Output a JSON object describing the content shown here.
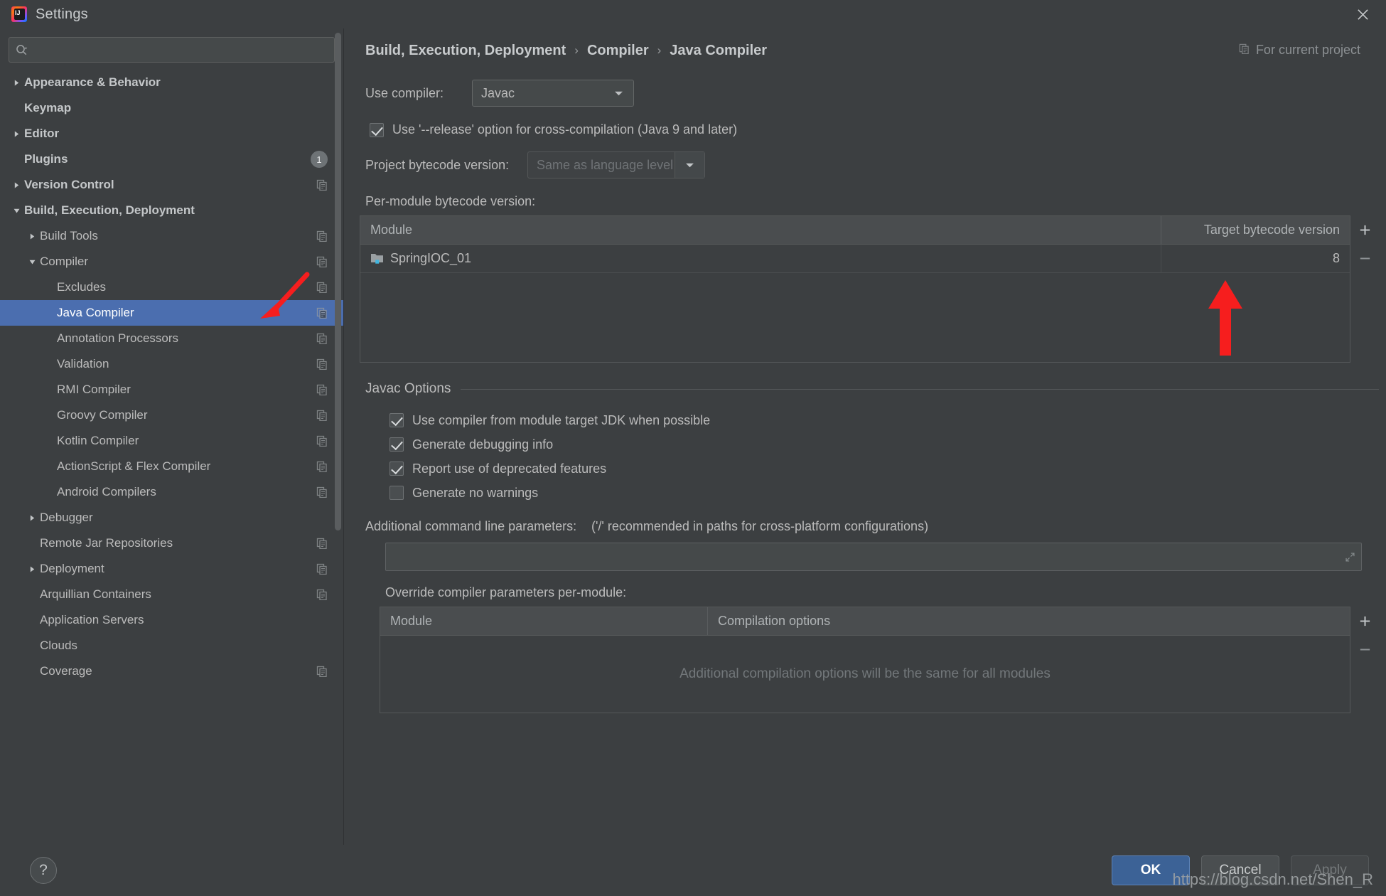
{
  "window": {
    "title": "Settings",
    "close_icon": "close-icon",
    "app_logo": "intellij-idea-logo"
  },
  "search": {
    "placeholder": "",
    "value": "",
    "icon": "search-icon"
  },
  "sidebar": {
    "items": [
      {
        "label": "Appearance & Behavior",
        "level": 0,
        "arrow": "right",
        "bold": true,
        "copy": false,
        "badge": null,
        "selected": false
      },
      {
        "label": "Keymap",
        "level": 0,
        "arrow": "none",
        "bold": true,
        "copy": false,
        "badge": null,
        "selected": false
      },
      {
        "label": "Editor",
        "level": 0,
        "arrow": "right",
        "bold": true,
        "copy": false,
        "badge": null,
        "selected": false
      },
      {
        "label": "Plugins",
        "level": 0,
        "arrow": "none",
        "bold": true,
        "copy": false,
        "badge": "1",
        "selected": false
      },
      {
        "label": "Version Control",
        "level": 0,
        "arrow": "right",
        "bold": true,
        "copy": true,
        "badge": null,
        "selected": false
      },
      {
        "label": "Build, Execution, Deployment",
        "level": 0,
        "arrow": "down",
        "bold": true,
        "copy": false,
        "badge": null,
        "selected": false
      },
      {
        "label": "Build Tools",
        "level": 1,
        "arrow": "right",
        "bold": false,
        "copy": true,
        "badge": null,
        "selected": false
      },
      {
        "label": "Compiler",
        "level": 1,
        "arrow": "down",
        "bold": false,
        "copy": true,
        "badge": null,
        "selected": false
      },
      {
        "label": "Excludes",
        "level": 2,
        "arrow": "none",
        "bold": false,
        "copy": true,
        "badge": null,
        "selected": false
      },
      {
        "label": "Java Compiler",
        "level": 2,
        "arrow": "none",
        "bold": false,
        "copy": true,
        "badge": null,
        "selected": true
      },
      {
        "label": "Annotation Processors",
        "level": 2,
        "arrow": "none",
        "bold": false,
        "copy": true,
        "badge": null,
        "selected": false
      },
      {
        "label": "Validation",
        "level": 2,
        "arrow": "none",
        "bold": false,
        "copy": true,
        "badge": null,
        "selected": false
      },
      {
        "label": "RMI Compiler",
        "level": 2,
        "arrow": "none",
        "bold": false,
        "copy": true,
        "badge": null,
        "selected": false
      },
      {
        "label": "Groovy Compiler",
        "level": 2,
        "arrow": "none",
        "bold": false,
        "copy": true,
        "badge": null,
        "selected": false
      },
      {
        "label": "Kotlin Compiler",
        "level": 2,
        "arrow": "none",
        "bold": false,
        "copy": true,
        "badge": null,
        "selected": false
      },
      {
        "label": "ActionScript & Flex Compiler",
        "level": 2,
        "arrow": "none",
        "bold": false,
        "copy": true,
        "badge": null,
        "selected": false
      },
      {
        "label": "Android Compilers",
        "level": 2,
        "arrow": "none",
        "bold": false,
        "copy": true,
        "badge": null,
        "selected": false
      },
      {
        "label": "Debugger",
        "level": 1,
        "arrow": "right",
        "bold": false,
        "copy": false,
        "badge": null,
        "selected": false
      },
      {
        "label": "Remote Jar Repositories",
        "level": 1,
        "arrow": "none",
        "bold": false,
        "copy": true,
        "badge": null,
        "selected": false
      },
      {
        "label": "Deployment",
        "level": 1,
        "arrow": "right",
        "bold": false,
        "copy": true,
        "badge": null,
        "selected": false
      },
      {
        "label": "Arquillian Containers",
        "level": 1,
        "arrow": "none",
        "bold": false,
        "copy": true,
        "badge": null,
        "selected": false
      },
      {
        "label": "Application Servers",
        "level": 1,
        "arrow": "none",
        "bold": false,
        "copy": false,
        "badge": null,
        "selected": false
      },
      {
        "label": "Clouds",
        "level": 1,
        "arrow": "none",
        "bold": false,
        "copy": false,
        "badge": null,
        "selected": false
      },
      {
        "label": "Coverage",
        "level": 1,
        "arrow": "none",
        "bold": false,
        "copy": true,
        "badge": null,
        "selected": false
      }
    ]
  },
  "breadcrumb": {
    "items": [
      "Build, Execution, Deployment",
      "Compiler",
      "Java Compiler"
    ],
    "separator": "›",
    "scope_label": "For current project",
    "scope_icon": "copy-settings-icon"
  },
  "main": {
    "use_compiler_label": "Use compiler:",
    "use_compiler_value": "Javac",
    "release_option_label": "Use '--release' option for cross-compilation (Java 9 and later)",
    "release_option_checked": true,
    "project_bytecode_label": "Project bytecode version:",
    "project_bytecode_value": "Same as language level",
    "project_bytecode_disabled": true,
    "per_module_label": "Per-module bytecode version:",
    "module_table": {
      "columns": [
        "Module",
        "Target bytecode version"
      ],
      "rows": [
        {
          "module": "SpringIOC_01",
          "target": "8",
          "icon": "module-folder-icon"
        }
      ],
      "add_label": "+",
      "remove_label": "−"
    },
    "javac_options_title": "Javac Options",
    "javac_options": [
      {
        "label": "Use compiler from module target JDK when possible",
        "checked": true
      },
      {
        "label": "Generate debugging info",
        "checked": true
      },
      {
        "label": "Report use of deprecated features",
        "checked": true
      },
      {
        "label": "Generate no warnings",
        "checked": false
      }
    ],
    "additional_params_label": "Additional command line parameters:",
    "additional_params_hint": "('/' recommended in paths for cross-platform configurations)",
    "additional_params_value": "",
    "override_label": "Override compiler parameters per-module:",
    "override_table": {
      "columns": [
        "Module",
        "Compilation options"
      ],
      "empty_message": "Additional compilation options will be the same for all modules",
      "add_label": "+",
      "remove_label": "−"
    }
  },
  "footer": {
    "help_label": "?",
    "ok_label": "OK",
    "cancel_label": "Cancel",
    "apply_label": "Apply",
    "apply_disabled": true
  },
  "watermark": {
    "text": "https://blog.csdn.net/Shen_R"
  },
  "colors": {
    "selection": "#4b6eaf",
    "accent_primary": "#3c6296",
    "annotation_arrow": "#f61e1e",
    "panel_bg": "#3c3f41",
    "field_bg": "#45494a"
  }
}
